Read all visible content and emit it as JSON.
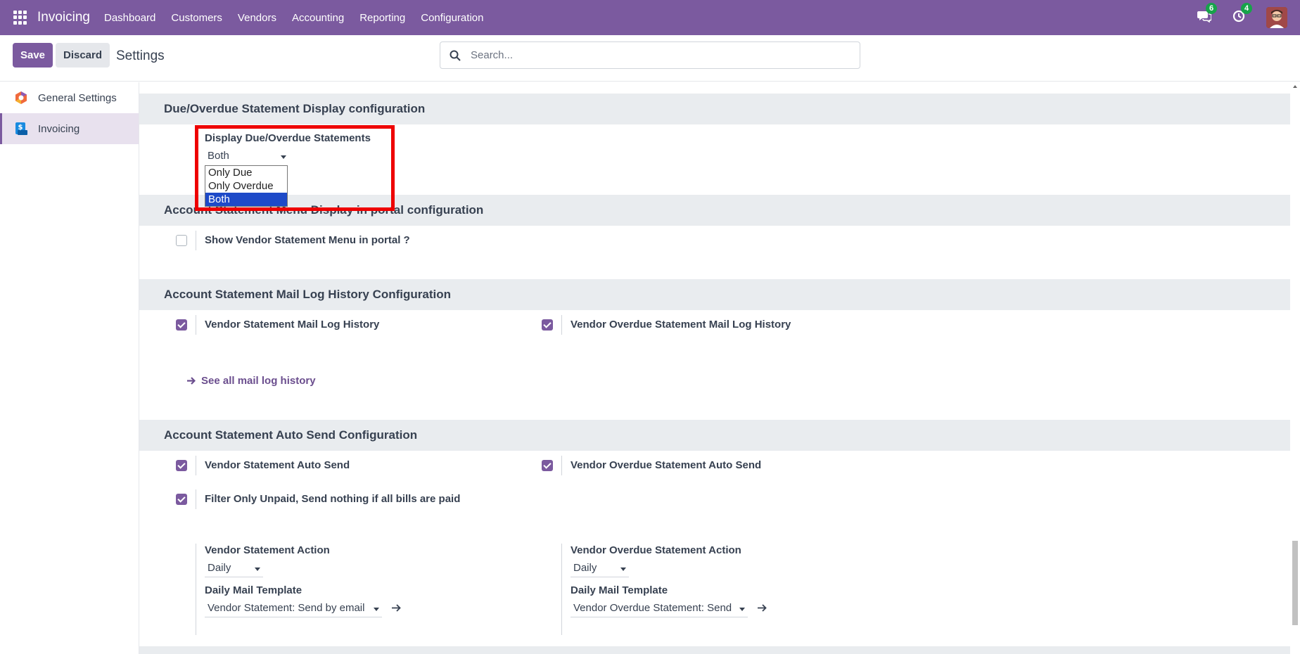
{
  "topbar": {
    "app_name": "Invoicing",
    "menu": [
      "Dashboard",
      "Customers",
      "Vendors",
      "Accounting",
      "Reporting",
      "Configuration"
    ],
    "messages_count": "6",
    "activities_count": "4"
  },
  "control_panel": {
    "save_label": "Save",
    "discard_label": "Discard",
    "title": "Settings",
    "search_placeholder": "Search..."
  },
  "sidebar": {
    "items": [
      {
        "label": "General Settings",
        "icon": "odoo-logo-icon"
      },
      {
        "label": "Invoicing",
        "icon": "invoicing-app-icon"
      }
    ]
  },
  "sections": {
    "display": {
      "title": "Due/Overdue Statement Display configuration",
      "field_label": "Display Due/Overdue Statements",
      "value": "Both",
      "options": [
        "Only Due",
        "Only Overdue",
        "Both"
      ]
    },
    "portal": {
      "title": "Account Statement Menu Display in portal configuration",
      "checkbox_label": "Show Vendor Statement Menu in portal ?"
    },
    "maillog": {
      "title": "Account Statement Mail Log History Configuration",
      "left_label": "Vendor Statement Mail Log History",
      "right_label": "Vendor Overdue Statement Mail Log History",
      "link": "See all mail log history"
    },
    "autosend": {
      "title": "Account Statement Auto Send Configuration",
      "left_label": "Vendor Statement Auto Send",
      "right_label": "Vendor Overdue Statement Auto Send",
      "filter_label": "Filter Only Unpaid, Send nothing if all bills are paid",
      "left_action_label": "Vendor Statement Action",
      "left_action_value": "Daily",
      "left_template_label": "Daily Mail Template",
      "left_template_value": "Vendor Statement: Send by email",
      "right_action_label": "Vendor Overdue Statement Action",
      "right_action_value": "Daily",
      "right_template_label": "Daily Mail Template",
      "right_template_value": "Vendor Overdue Statement: Send"
    }
  },
  "colors": {
    "brand": "#7b5a9f",
    "highlight": "#ee0000",
    "selected_option": "#1e4ac8"
  }
}
